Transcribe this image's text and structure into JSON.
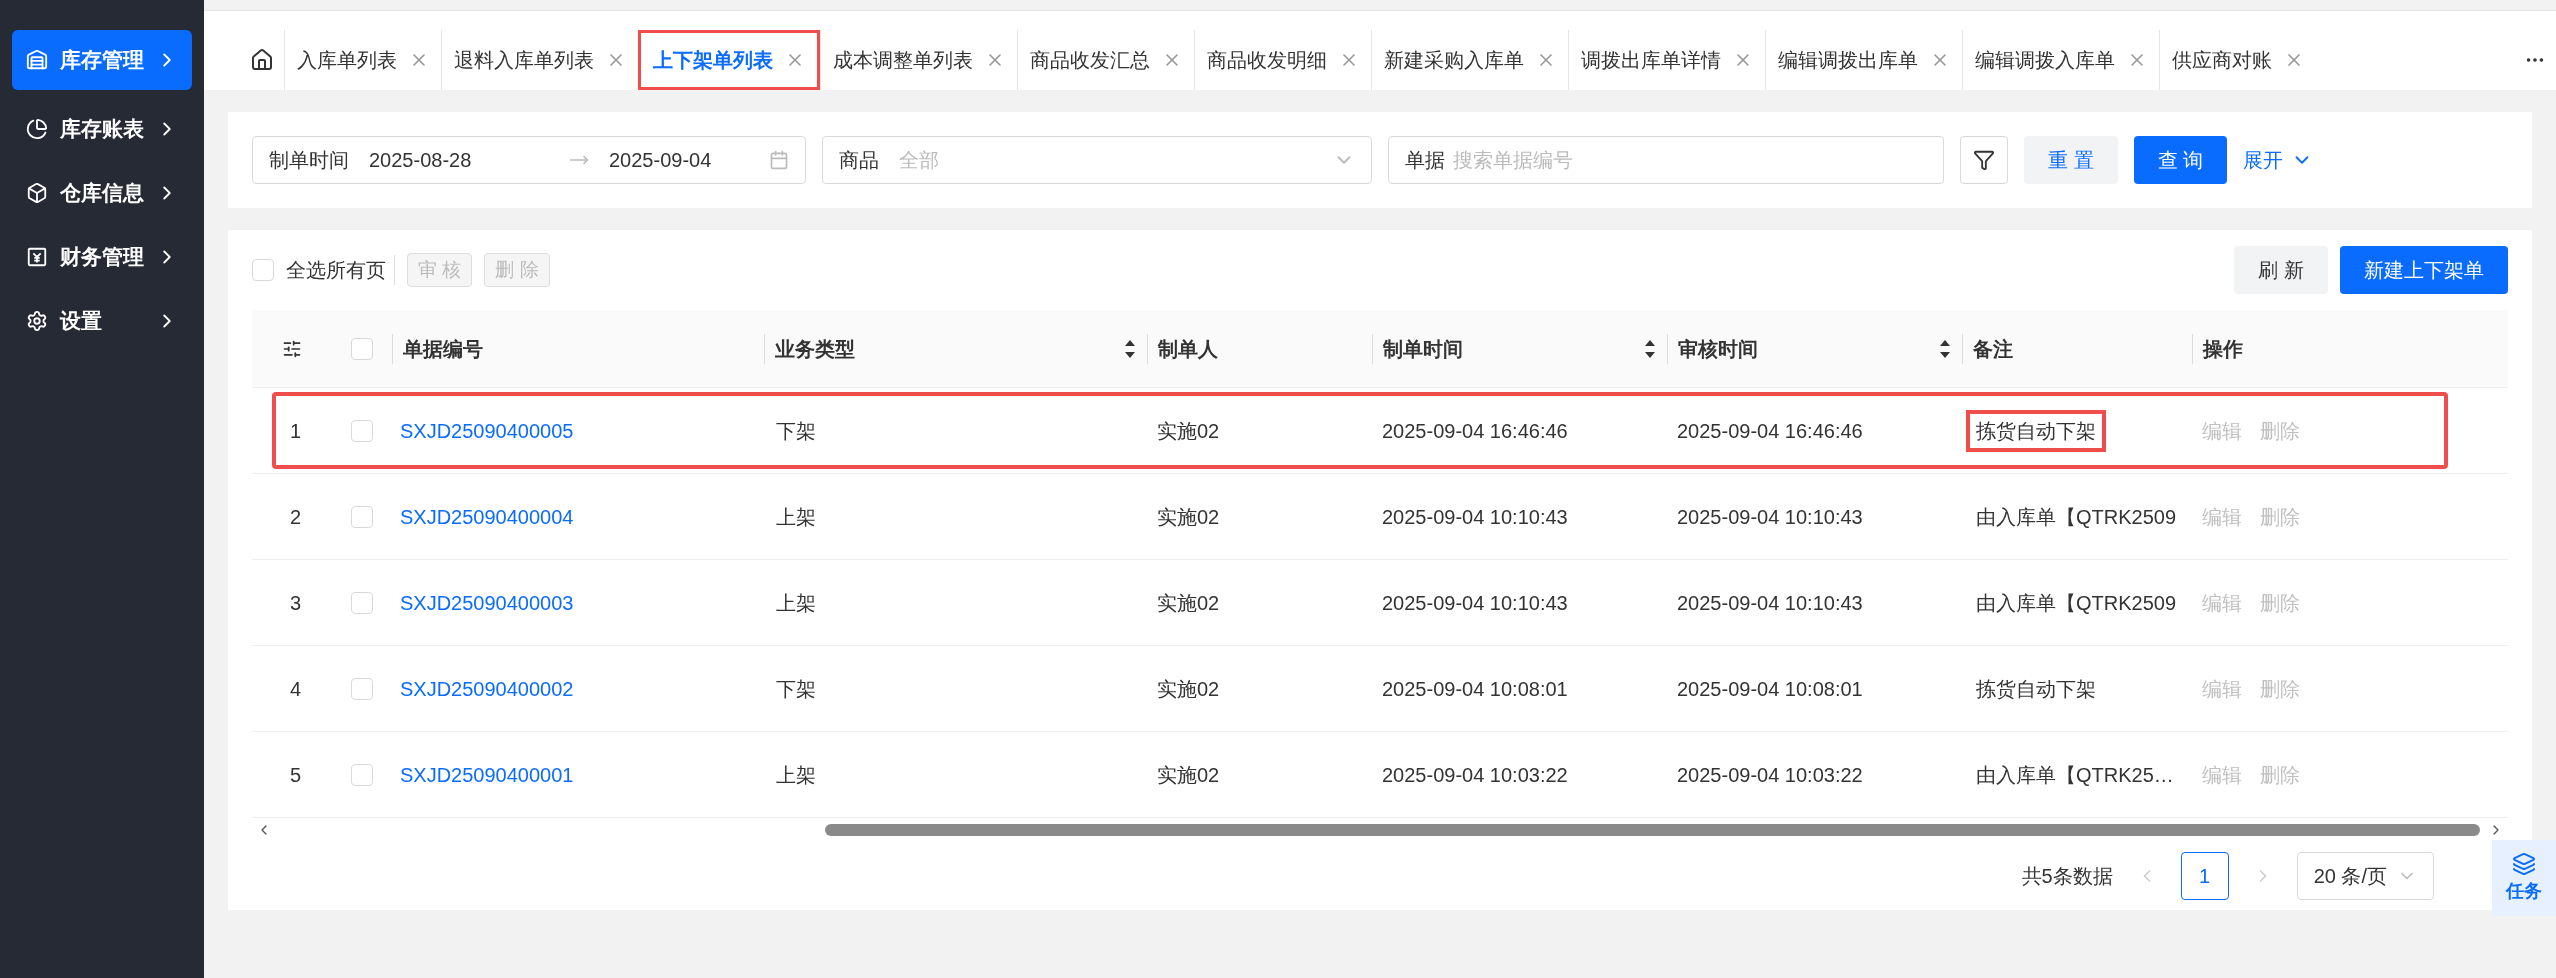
{
  "sidebar": {
    "items": [
      {
        "label": "库存管理",
        "kind": "warehouse",
        "selected": true
      },
      {
        "label": "库存账表",
        "kind": "chart",
        "selected": false
      },
      {
        "label": "仓库信息",
        "kind": "box",
        "selected": false
      },
      {
        "label": "财务管理",
        "kind": "finance",
        "selected": false
      },
      {
        "label": "设置",
        "kind": "settings",
        "selected": false
      }
    ]
  },
  "tabs": [
    {
      "label": "入库单列表",
      "selected": false,
      "highlighted": false
    },
    {
      "label": "退料入库单列表",
      "selected": false,
      "highlighted": false
    },
    {
      "label": "上下架单列表",
      "selected": true,
      "highlighted": true
    },
    {
      "label": "成本调整单列表",
      "selected": false,
      "highlighted": false
    },
    {
      "label": "商品收发汇总",
      "selected": false,
      "highlighted": false
    },
    {
      "label": "商品收发明细",
      "selected": false,
      "highlighted": false
    },
    {
      "label": "新建采购入库单",
      "selected": false,
      "highlighted": false
    },
    {
      "label": "调拨出库单详情",
      "selected": false,
      "highlighted": false
    },
    {
      "label": "编辑调拨出库单",
      "selected": false,
      "highlighted": false
    },
    {
      "label": "编辑调拨入库单",
      "selected": false,
      "highlighted": false
    },
    {
      "label": "供应商对账",
      "selected": false,
      "highlighted": false
    }
  ],
  "filters": {
    "date_label": "制单时间",
    "date_start": "2025-08-28",
    "date_end": "2025-09-04",
    "product_label": "商品",
    "product_placeholder": "全部",
    "doc_label": "单据",
    "doc_placeholder": "搜索单据编号",
    "reset": "重 置",
    "query": "查 询",
    "expand": "展开"
  },
  "toolbar": {
    "select_all": {
      "label": "全选所有页",
      "checked": false
    },
    "audit": "审 核",
    "delete": "删 除",
    "refresh": "刷 新",
    "create": "新建上下架单"
  },
  "table": {
    "header_checked": false,
    "columns": [
      {
        "label": "单据编号",
        "sortable": false
      },
      {
        "label": "业务类型",
        "sortable": true
      },
      {
        "label": "制单人",
        "sortable": false
      },
      {
        "label": "制单时间",
        "sortable": true
      },
      {
        "label": "审核时间",
        "sortable": true
      },
      {
        "label": "备注",
        "sortable": false
      },
      {
        "label": "操作",
        "sortable": false
      }
    ],
    "rows": [
      {
        "index": "1",
        "checked": false,
        "highlighted": true,
        "number": "SXJD25090400005",
        "type": "下架",
        "creator": "实施02",
        "created": "2025-09-04 16:46:46",
        "audited": "2025-09-04 16:46:46",
        "remark": "拣货自动下架",
        "remark_highlighted": true,
        "actions": [
          "编辑",
          "删除"
        ]
      },
      {
        "index": "2",
        "checked": false,
        "highlighted": false,
        "number": "SXJD25090400004",
        "type": "上架",
        "creator": "实施02",
        "created": "2025-09-04 10:10:43",
        "audited": "2025-09-04 10:10:43",
        "remark": "由入库单【QTRK2509",
        "remark_highlighted": false,
        "actions": [
          "编辑",
          "删除"
        ]
      },
      {
        "index": "3",
        "checked": false,
        "highlighted": false,
        "number": "SXJD25090400003",
        "type": "上架",
        "creator": "实施02",
        "created": "2025-09-04 10:10:43",
        "audited": "2025-09-04 10:10:43",
        "remark": "由入库单【QTRK2509",
        "remark_highlighted": false,
        "actions": [
          "编辑",
          "删除"
        ]
      },
      {
        "index": "4",
        "checked": false,
        "highlighted": false,
        "number": "SXJD25090400002",
        "type": "下架",
        "creator": "实施02",
        "created": "2025-09-04 10:08:01",
        "audited": "2025-09-04 10:08:01",
        "remark": "拣货自动下架",
        "remark_highlighted": false,
        "actions": [
          "编辑",
          "删除"
        ]
      },
      {
        "index": "5",
        "checked": false,
        "highlighted": false,
        "number": "SXJD25090400001",
        "type": "上架",
        "creator": "实施02",
        "created": "2025-09-04 10:03:22",
        "audited": "2025-09-04 10:03:22",
        "remark": "由入库单【QTRK25…",
        "remark_highlighted": false,
        "actions": [
          "编辑",
          "删除"
        ]
      }
    ]
  },
  "pagination": {
    "total": "共5条数据",
    "pages": [
      {
        "label": "1",
        "selected": true
      }
    ],
    "page_size": "20 条/页"
  },
  "task_button": "任务"
}
